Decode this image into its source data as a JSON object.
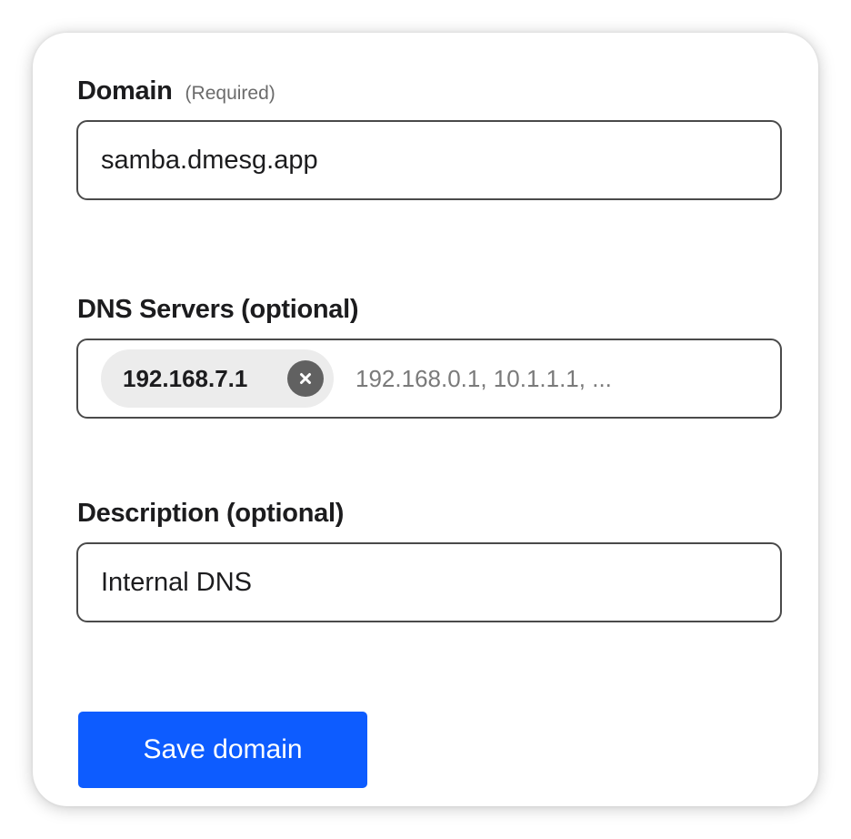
{
  "form": {
    "domain": {
      "label": "Domain",
      "hint": "(Required)",
      "value": "samba.dmesg.app"
    },
    "dns_servers": {
      "label": "DNS Servers (optional)",
      "tags": [
        "192.168.7.1"
      ],
      "remove_icon": "close-icon",
      "placeholder": "192.168.0.1, 10.1.1.1, ..."
    },
    "description": {
      "label": "Description (optional)",
      "value": "Internal DNS"
    },
    "save_label": "Save domain"
  },
  "colors": {
    "accent": "#0d5cff",
    "border": "#4a4a4a",
    "chip_bg": "#ececec",
    "chip_remove_bg": "#616161"
  }
}
